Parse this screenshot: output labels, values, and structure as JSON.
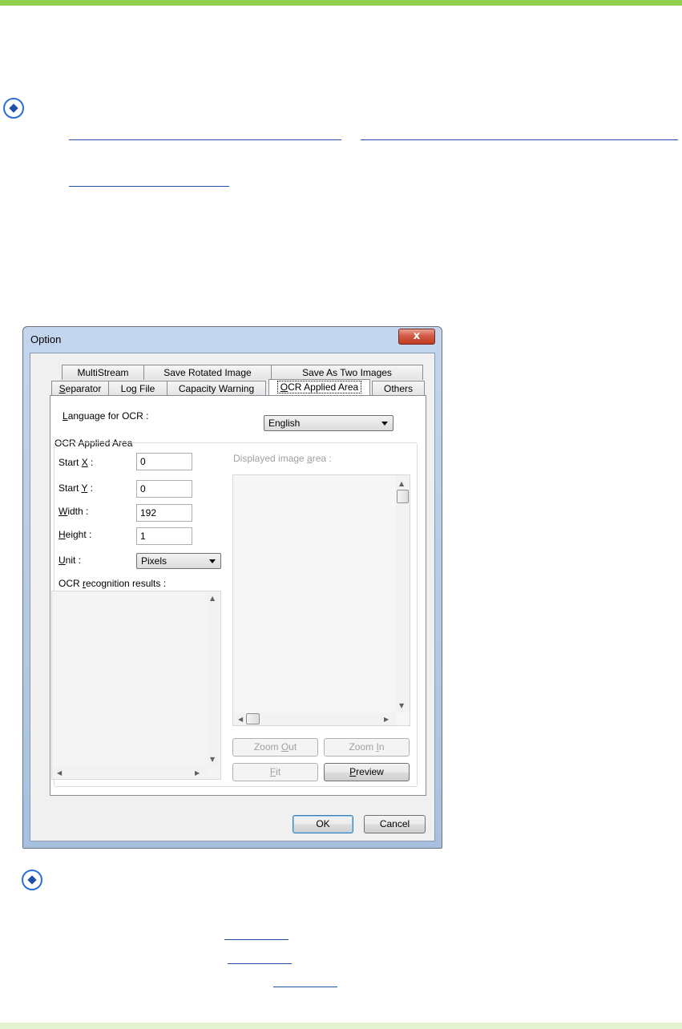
{
  "dialog": {
    "title": "Option",
    "close_glyph": "x",
    "tabs_row1": [
      "MultiStream",
      "Save Rotated Image",
      "Save As Two Images"
    ],
    "tabs_row2": [
      {
        "pre": "",
        "acc": "S",
        "post": "eparator"
      },
      {
        "pre": "",
        "acc": "",
        "post": "Log File"
      },
      {
        "pre": "",
        "acc": "",
        "post": "Capacity Warning"
      },
      {
        "pre": "",
        "acc": "O",
        "post": "CR Applied Area"
      },
      {
        "pre": "",
        "acc": "",
        "post": "Others"
      }
    ],
    "language": {
      "pre": "",
      "acc": "L",
      "post": "anguage for OCR :",
      "value": "English"
    },
    "group_title": "OCR Applied Area",
    "fields": [
      {
        "pre": "Start ",
        "acc": "X",
        "post": " :",
        "value": "0"
      },
      {
        "pre": "Start ",
        "acc": "Y",
        "post": " :",
        "value": "0"
      },
      {
        "pre": "",
        "acc": "W",
        "post": "idth :",
        "value": "192"
      },
      {
        "pre": "",
        "acc": "H",
        "post": "eight :",
        "value": "1"
      }
    ],
    "unit": {
      "pre": "",
      "acc": "U",
      "post": "nit :",
      "value": "Pixels"
    },
    "results_label": {
      "pre": "OCR ",
      "acc": "r",
      "post": "ecognition results :"
    },
    "display_label": {
      "pre": "Displayed image ",
      "acc": "a",
      "post": "rea :"
    },
    "buttons": {
      "zoom_out": {
        "pre": "Zoom ",
        "acc": "O",
        "post": "ut"
      },
      "zoom_in": {
        "pre": "Zoom ",
        "acc": "I",
        "post": "n"
      },
      "fit": {
        "pre": "",
        "acc": "F",
        "post": "it"
      },
      "preview": {
        "pre": "",
        "acc": "P",
        "post": "review"
      },
      "ok": "OK",
      "cancel": "Cancel"
    }
  },
  "colors": {
    "accent_bar": "#92d050",
    "bottom_bar": "#e4f4d2",
    "link": "#1f4fa8",
    "note_icon": "#2b6fd6"
  },
  "icons": [
    "note-icon",
    "close-icon",
    "dropdown-arrow-icon",
    "scroll-up-icon",
    "scroll-down-icon",
    "scroll-left-icon",
    "scroll-right-icon"
  ]
}
